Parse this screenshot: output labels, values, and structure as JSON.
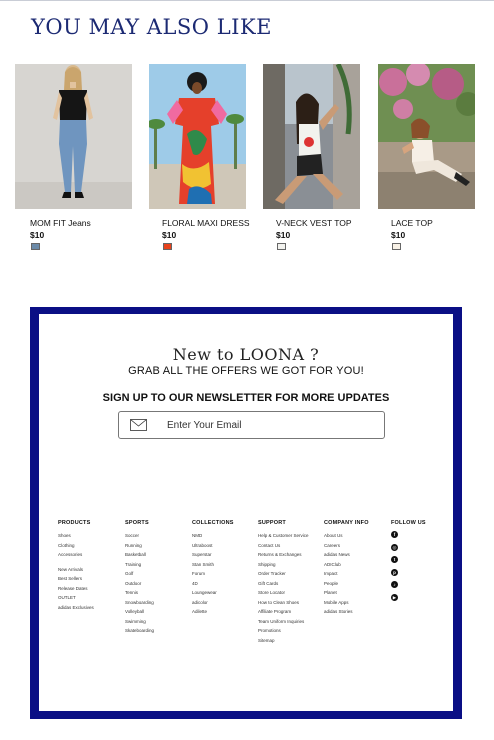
{
  "heading": "YOU MAY ALSO LIKE",
  "products": [
    {
      "name": "MOM FIT Jeans",
      "price": "$10",
      "swatch_color": "#6b8aa8"
    },
    {
      "name": "FLORAL MAXI DRESS",
      "price": "$10",
      "swatch_color": "#e8431c"
    },
    {
      "name": "V-NECK VEST TOP",
      "price": "$10",
      "swatch_color": "#f2f2ee"
    },
    {
      "name": "LACE TOP",
      "price": "$10",
      "swatch_color": "#f8f1e6"
    }
  ],
  "newsletter": {
    "title": "New to LOONA ?",
    "subtitle": "GRAB ALL THE OFFERS WE GOT FOR YOU!",
    "cta": "SIGN UP TO OUR NEWSLETTER FOR MORE UPDATES",
    "email_placeholder": "Enter Your Email",
    "border_color": "#0a0f85"
  },
  "footer": {
    "products": {
      "title": "PRODUCTS",
      "links": [
        "Shoes",
        "Clothing",
        "Accessories"
      ],
      "links2": [
        "New Arrivals",
        "Best Sellers",
        "Release Dates",
        "OUTLET",
        "adidas Exclusives"
      ]
    },
    "sports": {
      "title": "SPORTS",
      "links": [
        "Soccer",
        "Running",
        "Basketball",
        "Training",
        "Golf",
        "Outdoor",
        "Tennis",
        "Snowboarding",
        "Volleyball",
        "Swimming",
        "Skateboarding"
      ]
    },
    "collections": {
      "title": "COLLECTIONS",
      "links": [
        "NMD",
        "Ultraboost",
        "Superstar",
        "Stan Smith",
        "Forum",
        "4D",
        "Loungewear",
        "adicolor",
        "Adilette"
      ]
    },
    "support": {
      "title": "SUPPORT",
      "links": [
        "Help & Customer Service",
        "Contact Us",
        "Returns & Exchanges",
        "Shipping",
        "Order Tracker",
        "Gift Cards",
        "Store Locator",
        "How to Clean Shoes",
        "Affiliate Program",
        "Team Uniform Inquiries",
        "Promotions",
        "Sitemap"
      ]
    },
    "company": {
      "title": "COMPANY INFO",
      "links": [
        "About Us",
        "Careers",
        "adidas News",
        "ADIClub",
        "Impact",
        "People",
        "Planet",
        "Mobile Apps",
        "adidas Stories"
      ]
    },
    "follow": {
      "title": "FOLLOW US",
      "icons": [
        "facebook-icon",
        "instagram-icon",
        "twitter-icon",
        "pinterest-icon",
        "tiktok-icon",
        "youtube-icon"
      ]
    }
  }
}
